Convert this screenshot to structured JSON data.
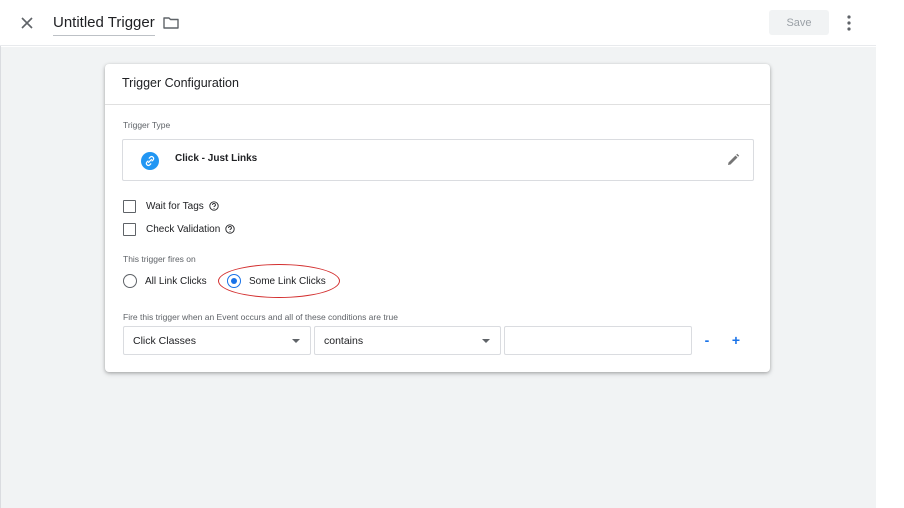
{
  "header": {
    "title": "Untitled Trigger",
    "save_label": "Save"
  },
  "card": {
    "title": "Trigger Configuration",
    "trigger_type_label": "Trigger Type",
    "trigger_type_value": "Click - Just Links",
    "options": {
      "wait_for_tags": "Wait for Tags",
      "check_validation": "Check Validation"
    },
    "fires_on_label": "This trigger fires on",
    "fires_on_options": {
      "all": "All Link Clicks",
      "some": "Some Link Clicks"
    },
    "fires_on_selected": "Some Link Clicks",
    "conditions_label": "Fire this trigger when an Event occurs and all of these conditions are true",
    "condition": {
      "variable": "Click Classes",
      "operator": "contains",
      "value": ""
    },
    "remove_label": "-",
    "add_label": "+"
  },
  "colors": {
    "accent": "#1a73e8",
    "trigger_icon": "#2196f3",
    "highlight": "#d32f2f",
    "canvas_bg": "#f1f3f4"
  }
}
